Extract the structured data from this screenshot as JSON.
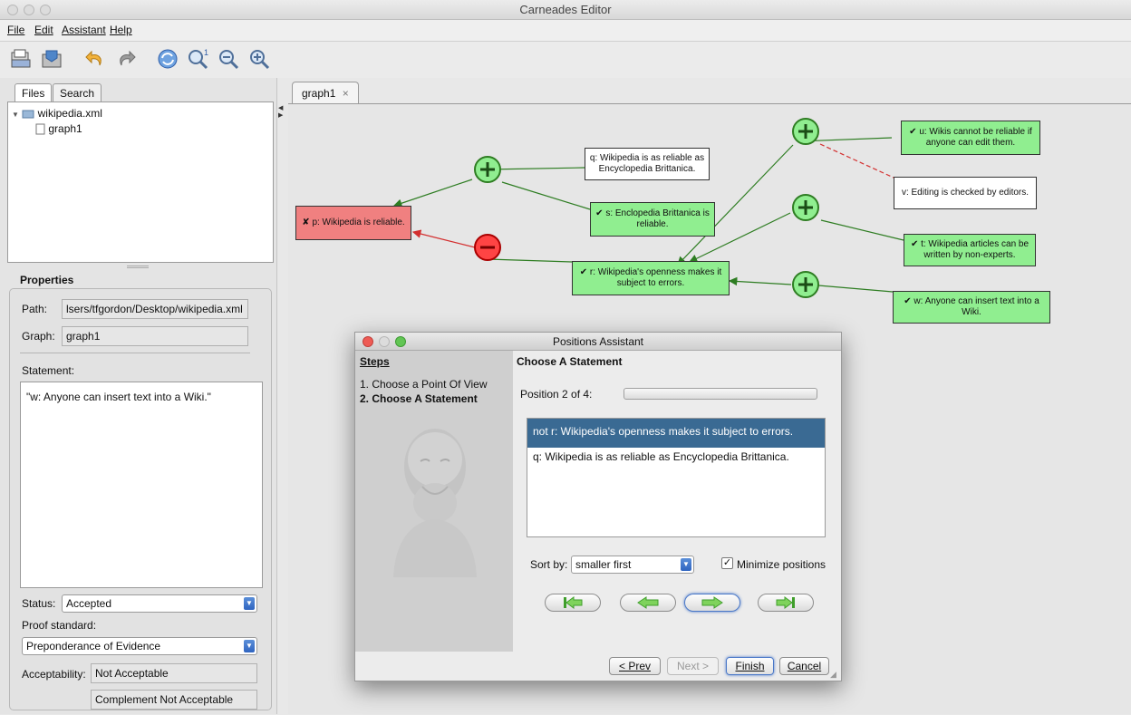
{
  "window": {
    "title": "Carneades Editor"
  },
  "menu": {
    "file": "File",
    "edit": "Edit",
    "assistant": "Assistant",
    "help": "Help"
  },
  "toolbar": {
    "icons": [
      "open-icon",
      "save-icon",
      "undo-icon",
      "redo-icon",
      "refresh-icon",
      "zoom-reset-icon",
      "zoom-out-icon",
      "zoom-in-icon"
    ],
    "zoom_badge": "1"
  },
  "left_tabs": {
    "files": "Files",
    "search": "Search"
  },
  "file_tree": {
    "root": "wikipedia.xml",
    "child": "graph1"
  },
  "properties": {
    "header": "Properties",
    "path_label": "Path:",
    "path_value": "lsers/tfgordon/Desktop/wikipedia.xml",
    "graph_label": "Graph:",
    "graph_value": "graph1",
    "statement_label": "Statement:",
    "statement_value": "\"w: Anyone can insert text into a Wiki.\"",
    "status_label": "Status:",
    "status_value": "Accepted",
    "proof_label": "Proof standard:",
    "proof_value": "Preponderance of Evidence",
    "acceptability_label": "Acceptability:",
    "acceptability_value": "Not Acceptable",
    "complement_value": "Complement Not Acceptable"
  },
  "graph_tab": {
    "label": "graph1",
    "close": "×"
  },
  "graph": {
    "nodes": {
      "q": "q: Wikipedia is as reliable as Encyclopedia Brittanica.",
      "p": "✘ p: Wikipedia is reliable.",
      "s": "✔ s: Enclopedia Brittanica is reliable.",
      "r": "✔ r: Wikipedia's openness makes it subject to errors.",
      "u": "✔ u: Wikis cannot be reliable if anyone can edit them.",
      "v": "v: Editing is checked by editors.",
      "t": "✔ t: Wikipedia articles can be written by non-experts.",
      "w": "✔ w: Anyone can insert text into a Wiki."
    },
    "colors": {
      "accepted": "#90ee90",
      "rejected": "#f08080",
      "pro": "#2e7d22",
      "con": "#d32f2f"
    }
  },
  "dialog": {
    "title": "Positions Assistant",
    "steps_header": "Steps",
    "step1": "1. Choose a Point Of View",
    "step2": "2. Choose A Statement",
    "content_header": "Choose A Statement",
    "position_label": "Position 2 of 4:",
    "progress": 0.0,
    "list": [
      "not r: Wikipedia's openness makes it subject to errors.",
      "q: Wikipedia is as reliable as Encyclopedia Brittanica."
    ],
    "sort_label": "Sort by:",
    "sort_value": "smaller first",
    "minimize_label": "Minimize positions",
    "minimize_checked": true,
    "buttons": {
      "prev": "< Prev",
      "next": "Next >",
      "finish": "Finish",
      "cancel": "Cancel"
    }
  }
}
